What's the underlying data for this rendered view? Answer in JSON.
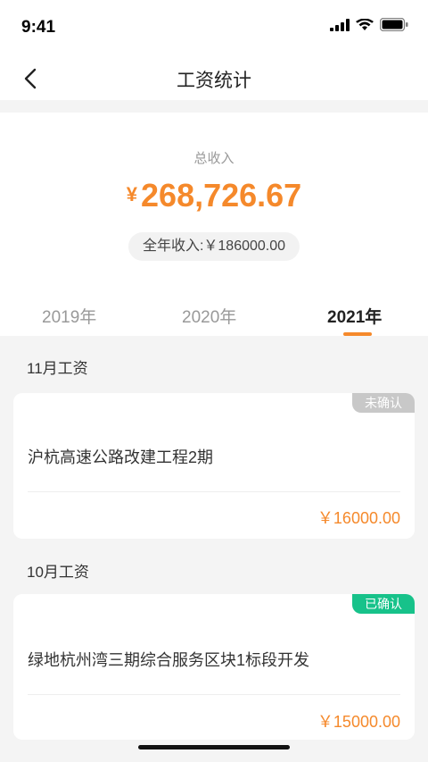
{
  "status": {
    "time": "9:41"
  },
  "nav": {
    "title": "工资统计"
  },
  "summary": {
    "total_label": "总收入",
    "currency": "¥",
    "total_amount": "268,726.67",
    "year_income": "全年收入:￥186000.00"
  },
  "tabs": [
    {
      "label": "2019年",
      "active": false
    },
    {
      "label": "2020年",
      "active": false
    },
    {
      "label": "2021年",
      "active": true
    }
  ],
  "months": [
    {
      "title": "11月工资",
      "project": "沪杭高速公路改建工程2期",
      "status": "未确认",
      "amount": "￥16000.00"
    },
    {
      "title": "10月工资",
      "project": "绿地杭州湾三期综合服务区块1标段开发",
      "status": "已确认",
      "amount": "￥15000.00"
    }
  ],
  "colors": {
    "accent": "#f5892b",
    "confirmed": "#17c28a",
    "pending": "#c8c8c8"
  }
}
